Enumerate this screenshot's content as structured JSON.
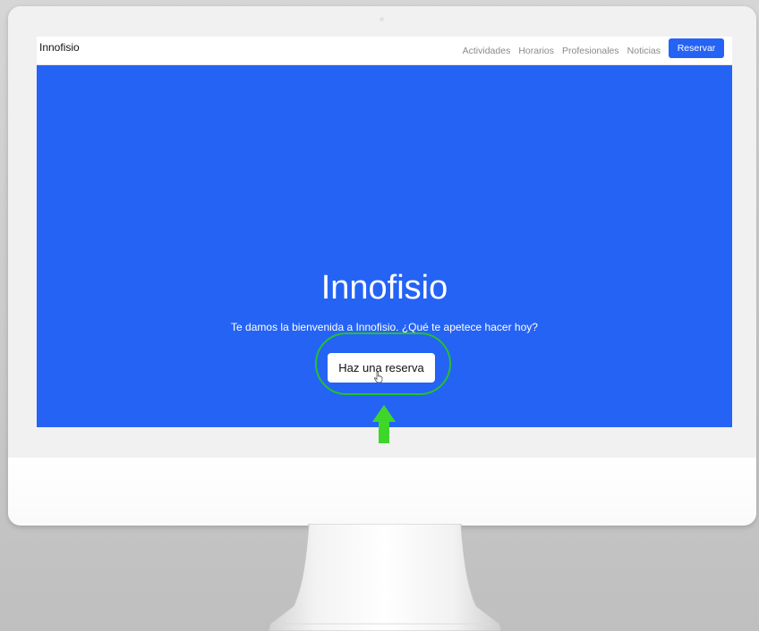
{
  "navbar": {
    "brand": "Innofisio",
    "links": [
      "Actividades",
      "Horarios",
      "Profesionales",
      "Noticias"
    ],
    "cta_label": "Reservar"
  },
  "hero": {
    "title": "Innofisio",
    "subtitle": "Te damos la bienvenida a Innofisio. ¿Qué te apetece hacer hoy?",
    "button_label": "Haz una reserva"
  },
  "icons": {
    "cursor": "hand-pointer-icon",
    "annotation_arrow": "arrow-up-icon",
    "annotation_ring": "highlight-ring"
  },
  "colors": {
    "accent": "#2563f5",
    "annotation": "#24c12c",
    "nav_text": "#8a8a8a"
  }
}
